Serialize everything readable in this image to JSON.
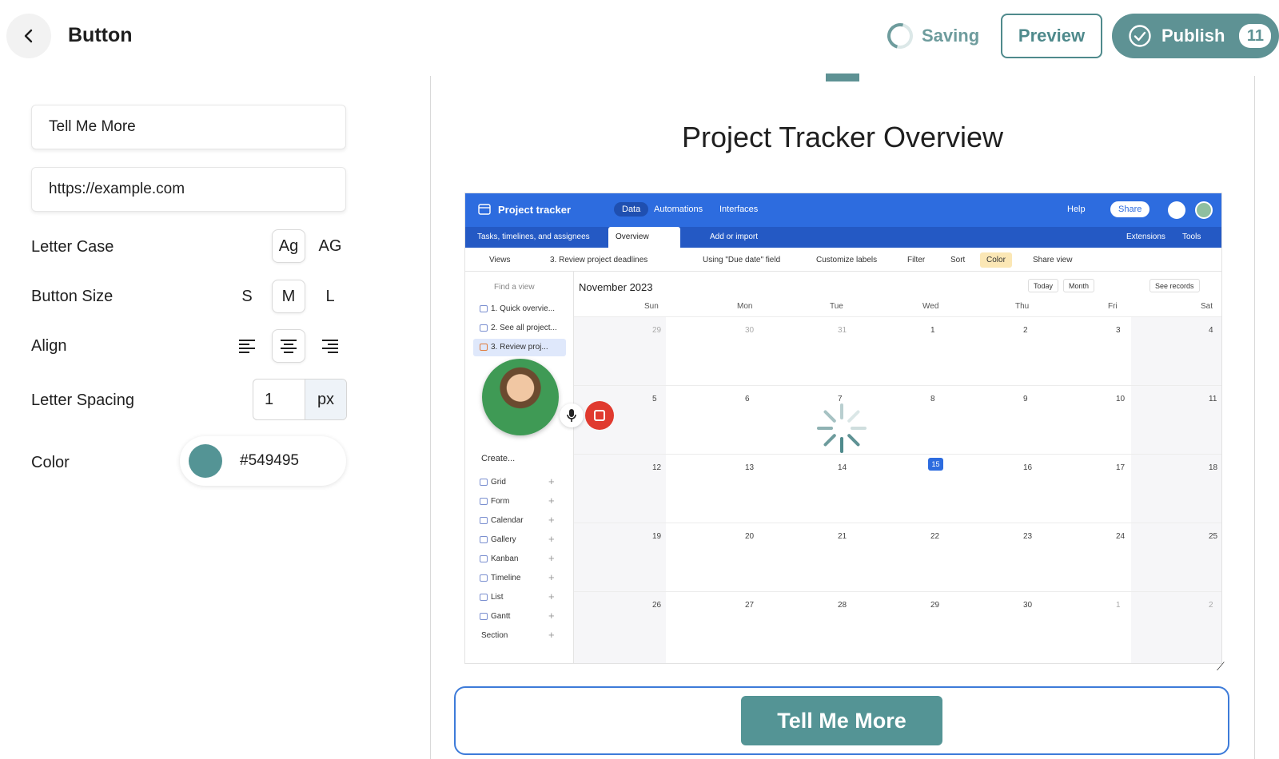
{
  "header": {
    "title": "Button",
    "saving_label": "Saving",
    "preview_label": "Preview",
    "publish_label": "Publish",
    "publish_count": "11"
  },
  "settings": {
    "button_text": "Tell Me More",
    "button_url": "https://example.com",
    "letter_case_label": "Letter Case",
    "letter_case_options": [
      "Ag",
      "AG"
    ],
    "letter_case_selected": "Ag",
    "button_size_label": "Button Size",
    "button_size_options": [
      "S",
      "M",
      "L"
    ],
    "button_size_selected": "M",
    "align_label": "Align",
    "align_selected": "center",
    "letter_spacing_label": "Letter Spacing",
    "letter_spacing_value": "1",
    "letter_spacing_unit": "px",
    "color_label": "Color",
    "color_value": "#549495"
  },
  "preview": {
    "doc_title": "Project Tracker Overview",
    "cta_label": "Tell Me More"
  },
  "screenshot": {
    "app_name": "Project tracker",
    "head_tabs": [
      "Data",
      "Automations",
      "Interfaces"
    ],
    "help": "Help",
    "share": "Share",
    "table_tab": "Tasks, timelines, and assignees",
    "active_tab": "Overview",
    "add_import": "Add or import",
    "extensions": "Extensions",
    "tools": "Tools",
    "toolbar": [
      "Views",
      "3. Review project deadlines",
      "Using \"Due date\" field",
      "Customize labels",
      "Filter",
      "Sort",
      "Color",
      "Share view"
    ],
    "find_view": "Find a view",
    "views": [
      "1. Quick overvie...",
      "2. See all project...",
      "3. Review proj..."
    ],
    "create_label": "Create...",
    "create_items": [
      "Grid",
      "Form",
      "Calendar",
      "Gallery",
      "Kanban",
      "Timeline",
      "List",
      "Gantt",
      "Section"
    ],
    "month": "November 2023",
    "controls": [
      "Today",
      "Month",
      "See records"
    ],
    "weekdays": [
      "Sun",
      "Mon",
      "Tue",
      "Wed",
      "Thu",
      "Fri",
      "Sat"
    ],
    "weeks": [
      [
        "29",
        "30",
        "31",
        "1",
        "2",
        "3",
        "4"
      ],
      [
        "5",
        "6",
        "7",
        "8",
        "9",
        "10",
        "11"
      ],
      [
        "12",
        "13",
        "14",
        "15",
        "16",
        "17",
        "18"
      ],
      [
        "19",
        "20",
        "21",
        "22",
        "23",
        "24",
        "25"
      ],
      [
        "26",
        "27",
        "28",
        "29",
        "30",
        "1",
        "2"
      ]
    ]
  }
}
